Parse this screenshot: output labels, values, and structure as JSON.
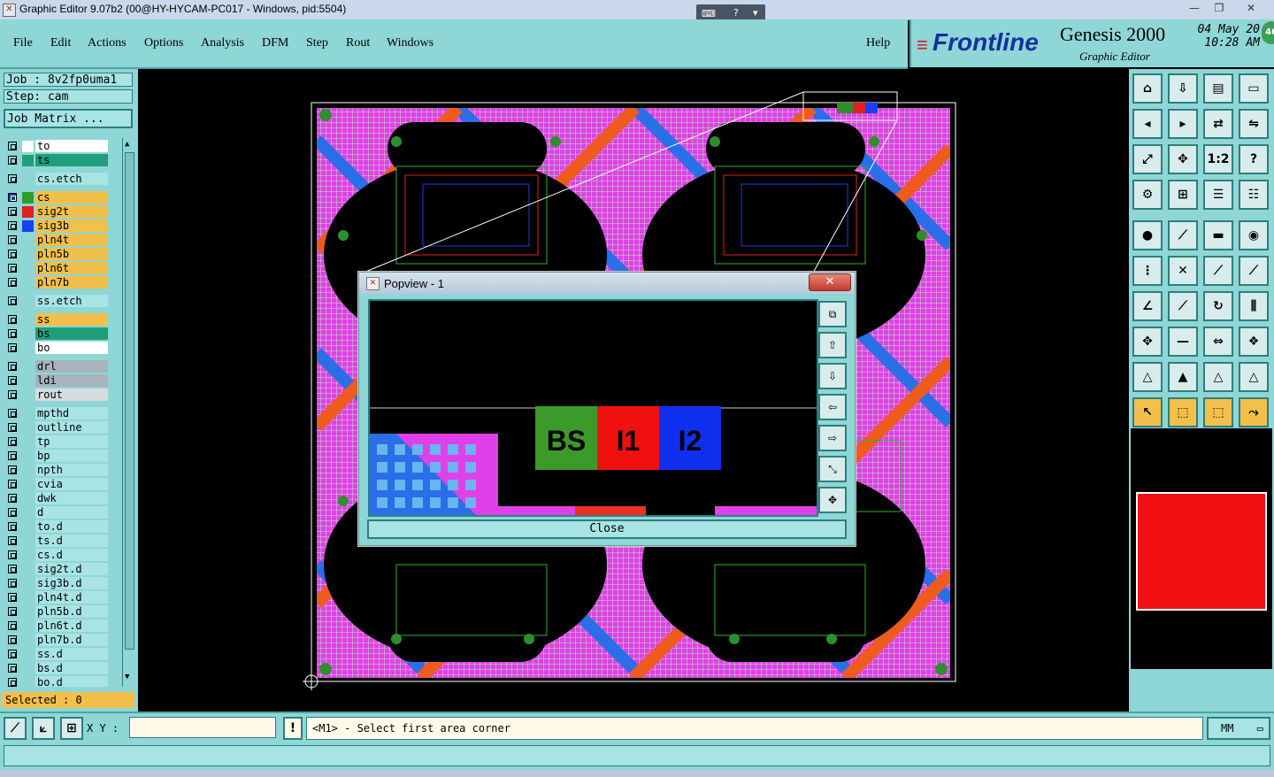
{
  "window": {
    "title": "Graphic Editor 9.07b2 (00@HY-HYCAM-PC017 - Windows, pid:5504)",
    "minimize": "—",
    "restore": "❐",
    "close": "✕"
  },
  "menu": {
    "items": [
      "File",
      "Edit",
      "Actions",
      "Options",
      "Analysis",
      "DFM",
      "Step",
      "Rout",
      "Windows"
    ],
    "help": "Help"
  },
  "brand": {
    "logo": "Frontline",
    "product": "Genesis 2000",
    "subtitle": "Graphic Editor",
    "date": "04 May 20",
    "time": "10:28 AM",
    "badge": "46"
  },
  "job": {
    "job_label": "Job : 8v2fp0uma1",
    "step_label": "Step: cam",
    "matrix_button": "Job Matrix ..."
  },
  "layers": [
    {
      "name": "to",
      "color": "#ffffff",
      "swatch": "#ffffff",
      "group": 0
    },
    {
      "name": "ts",
      "color": "#1f9e7a",
      "swatch": "#1f9e7a",
      "group": 0
    },
    {
      "name": "cs.etch",
      "color": "#a8e4e4",
      "swatch": "",
      "group": 1
    },
    {
      "name": "cs",
      "color": "#f2c04a",
      "swatch": "#2e9e2e",
      "group": 2,
      "active": true
    },
    {
      "name": "sig2t",
      "color": "#f2c04a",
      "swatch": "#e02020",
      "group": 2
    },
    {
      "name": "sig3b",
      "color": "#f2c04a",
      "swatch": "#1a3ef0",
      "group": 2
    },
    {
      "name": "pln4t",
      "color": "#f2c04a",
      "swatch": "",
      "group": 2
    },
    {
      "name": "pln5b",
      "color": "#f2c04a",
      "swatch": "",
      "group": 2
    },
    {
      "name": "pln6t",
      "color": "#f2c04a",
      "swatch": "",
      "group": 2
    },
    {
      "name": "pln7b",
      "color": "#f2c04a",
      "swatch": "",
      "group": 2
    },
    {
      "name": "ss.etch",
      "color": "#a8e4e4",
      "swatch": "",
      "group": 3
    },
    {
      "name": "ss",
      "color": "#f2c04a",
      "swatch": "",
      "group": 4
    },
    {
      "name": "bs",
      "color": "#1f9e7a",
      "swatch": "",
      "group": 4
    },
    {
      "name": "bo",
      "color": "#ffffff",
      "swatch": "",
      "group": 4
    },
    {
      "name": "drl",
      "color": "#a7b3bd",
      "swatch": "",
      "group": 5
    },
    {
      "name": "ldi",
      "color": "#a7b3bd",
      "swatch": "",
      "group": 5
    },
    {
      "name": "rout",
      "color": "#d8dcdf",
      "swatch": "",
      "group": 5
    },
    {
      "name": "mpthd",
      "color": "#a8e4e4",
      "swatch": "",
      "group": 6
    },
    {
      "name": "outline",
      "color": "#a8e4e4",
      "swatch": "",
      "group": 6
    },
    {
      "name": "tp",
      "color": "#a8e4e4",
      "swatch": "",
      "group": 6
    },
    {
      "name": "bp",
      "color": "#a8e4e4",
      "swatch": "",
      "group": 6
    },
    {
      "name": "npth",
      "color": "#a8e4e4",
      "swatch": "",
      "group": 6
    },
    {
      "name": "cvia",
      "color": "#a8e4e4",
      "swatch": "",
      "group": 6
    },
    {
      "name": "dwk",
      "color": "#a8e4e4",
      "swatch": "",
      "group": 6
    },
    {
      "name": "d",
      "color": "#a8e4e4",
      "swatch": "",
      "group": 6
    },
    {
      "name": "to.d",
      "color": "#a8e4e4",
      "swatch": "",
      "group": 6
    },
    {
      "name": "ts.d",
      "color": "#a8e4e4",
      "swatch": "",
      "group": 6
    },
    {
      "name": "cs.d",
      "color": "#a8e4e4",
      "swatch": "",
      "group": 6
    },
    {
      "name": "sig2t.d",
      "color": "#a8e4e4",
      "swatch": "",
      "group": 6
    },
    {
      "name": "sig3b.d",
      "color": "#a8e4e4",
      "swatch": "",
      "group": 6
    },
    {
      "name": "pln4t.d",
      "color": "#a8e4e4",
      "swatch": "",
      "group": 6
    },
    {
      "name": "pln5b.d",
      "color": "#a8e4e4",
      "swatch": "",
      "group": 6
    },
    {
      "name": "pln6t.d",
      "color": "#a8e4e4",
      "swatch": "",
      "group": 6
    },
    {
      "name": "pln7b.d",
      "color": "#a8e4e4",
      "swatch": "",
      "group": 6
    },
    {
      "name": "ss.d",
      "color": "#a8e4e4",
      "swatch": "",
      "group": 6
    },
    {
      "name": "bs.d",
      "color": "#a8e4e4",
      "swatch": "",
      "group": 6
    },
    {
      "name": "bo.d",
      "color": "#a8e4e4",
      "swatch": "",
      "group": 6
    }
  ],
  "selected_label": "Selected : 0",
  "popview": {
    "title": "Popview - 1",
    "close_x": "✕",
    "close_button": "Close",
    "labels": [
      "BS",
      "I1",
      "I2"
    ]
  },
  "toolbar_glyphs": {
    "one_to_two": "1:2",
    "help": "?"
  },
  "bottom": {
    "xy_label": "X Y :",
    "xy_value": "",
    "prompt": "<M1> - Select first area corner",
    "units": "MM",
    "warn": "!"
  },
  "colors": {
    "panel": "#8fd6d6",
    "layer_active": "#f2c04a",
    "board_magenta": "#e040e8",
    "stripe_blue": "#2a6ee8",
    "stripe_orange": "#ef5a1e"
  }
}
